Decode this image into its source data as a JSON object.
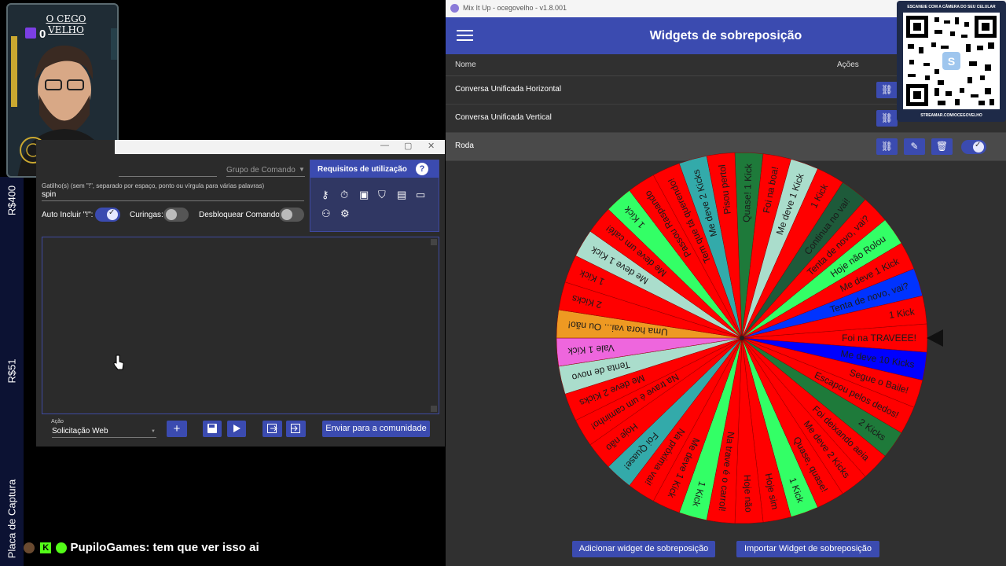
{
  "avatar": {
    "title": "O CEGO VELHO",
    "count": "0"
  },
  "left_strip": {
    "label_top": "R$400",
    "label_mid": "R$51",
    "label_bottom": "Placa de Captura"
  },
  "dialog": {
    "group_label": "Grupo de Comando",
    "trigger_label": "Gatilho(s) (sem \"!\", separado por espaço, ponto ou vírgula para várias palavras)",
    "trigger_value": "spin",
    "auto_include_label": "Auto Incluir \"!\":",
    "wildcards_label": "Curingas:",
    "unlock_label": "Desbloquear Comando:",
    "requirements_title": "Requisitos de utilização",
    "help_symbol": "?",
    "action_label": "Ação",
    "action_value": "Solicitação Web",
    "add_symbol": "+",
    "community_button": "Enviar para a comunidade"
  },
  "app": {
    "window_title": "Mix It Up - ocegovelho - v1.8.001",
    "page_title": "Widgets de sobreposição",
    "col_name": "Nome",
    "col_actions": "Ações",
    "rows": [
      {
        "name": "Conversa Unificada Horizontal"
      },
      {
        "name": "Conversa Unificada Vertical"
      },
      {
        "name": "Roda"
      }
    ],
    "add_button": "Adicionar widget de sobreposição",
    "import_button": "Importar Widget de sobreposição"
  },
  "qr": {
    "top_text": "ESCANEIE COM A CÂMERA DO SEU CELULAR",
    "bottom_text": "STREAMAR.COM/OCEGOVELHO"
  },
  "chat": {
    "user": "PupiloGames",
    "message": "tem que ver isso ai"
  },
  "wheel": {
    "labels": [
      "Foi na TRAVEEE!",
      "Me deve 10 Kicks",
      "Segue o Baile!",
      "Escapou pelos dedos!",
      "2 Kicks",
      "Foi deixando aeia",
      "Me deve 2 Kicks",
      "Quase, quase!",
      "1 Kick",
      "Hoje sim",
      "Hoje não",
      "Na trave é o carrol!",
      "1 Kick",
      "Me deve 1 Kick",
      "Na próxima vai!",
      "Foi Quase!",
      "Hoje não",
      "Na trave é um caminho!",
      "Me deve 2 Kicks",
      "Tenta de novo",
      "Vale 1 Kick",
      "Uma hora vai... Ou não!",
      "2 Kicks",
      "1 Kick",
      "Me deve 1 Kick",
      "Me deve um café!",
      "1 Kick",
      "Passou Raspando",
      "Tem que tá querendo!",
      "Me deve 2 Kicks",
      "Pisou pertol",
      "Quase! 1 Kick",
      "Foi na boa!",
      "Me deve 1 Kick",
      "1 Kick",
      "Continua no vai!",
      "Tenta de novo, vai?",
      "Hoje não Rolou",
      "Me deve 1 Kick",
      "Tenta de novo, vai?",
      "1 Kick"
    ],
    "colors": [
      "#ff0000",
      "#0000ff",
      "#ff0000",
      "#ff0000",
      "#1e7a3a",
      "#ff0000",
      "#ff0000",
      "#ff0000",
      "#33ff66",
      "#ff0000",
      "#ff0000",
      "#ff0000",
      "#33ff66",
      "#ff0000",
      "#ff0000",
      "#33aaaa",
      "#ff0000",
      "#ff0000",
      "#ff0000",
      "#aaddcc",
      "#ee66dd",
      "#ee9922",
      "#ff0000",
      "#ff0000",
      "#aaddcc",
      "#ff0000",
      "#33ff66",
      "#ff0000",
      "#ff0000",
      "#33aaaa",
      "#ff0000",
      "#1e7a3a",
      "#ff0000",
      "#aaddcc",
      "#ff0000",
      "#1e5a3a",
      "#ff0000",
      "#33ff66",
      "#ff0000",
      "#0033ff",
      "#ff0000"
    ]
  }
}
